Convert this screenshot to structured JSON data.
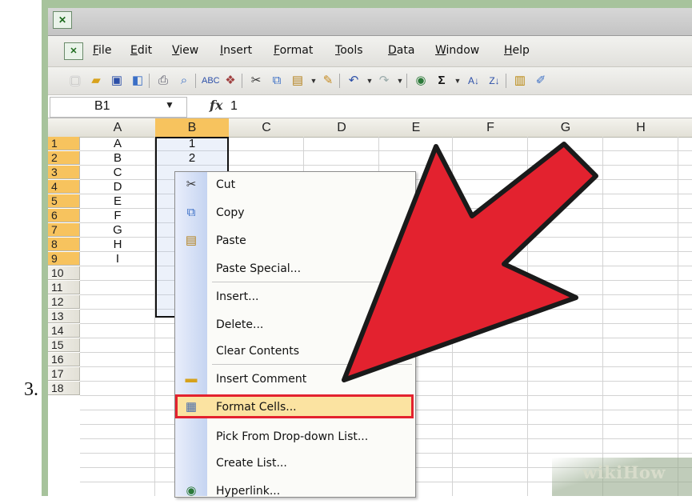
{
  "step_label": "3.",
  "menubar": {
    "items": [
      "File",
      "Edit",
      "View",
      "Insert",
      "Format",
      "Tools",
      "Data",
      "Window",
      "Help"
    ]
  },
  "toolbar": {
    "icons": [
      "new-icon",
      "open-icon",
      "save-icon",
      "permission-icon",
      "print-icon",
      "print-preview-icon",
      "spelling-icon",
      "research-icon",
      "cut-icon",
      "copy-icon",
      "paste-icon",
      "format-painter-icon",
      "undo-icon",
      "redo-icon",
      "hyperlink-icon",
      "autosum-icon",
      "sort-ascending-icon",
      "sort-descending-icon",
      "chart-wizard-icon",
      "drawing-icon"
    ],
    "autosum_label": "Σ"
  },
  "formula_bar": {
    "name_box": "B1",
    "fx_label": "fx",
    "value": "1"
  },
  "sheet": {
    "columns": [
      "A",
      "B",
      "C",
      "D",
      "E",
      "F",
      "G",
      "H"
    ],
    "rows": [
      "1",
      "2",
      "3",
      "4",
      "5",
      "6",
      "7",
      "8",
      "9",
      "10",
      "11",
      "12",
      "13",
      "14",
      "15",
      "16",
      "17",
      "18"
    ],
    "col_a": [
      "A",
      "B",
      "C",
      "D",
      "E",
      "F",
      "G",
      "H",
      "I"
    ],
    "col_b_visible": [
      "1",
      "2"
    ],
    "selected_column": "B"
  },
  "context_menu": {
    "items": [
      {
        "label": "Cut",
        "icon": "scissors-icon"
      },
      {
        "label": "Copy",
        "icon": "copy-icon"
      },
      {
        "label": "Paste",
        "icon": "clipboard-icon"
      },
      {
        "label": "Paste Special...",
        "icon": ""
      },
      {
        "label": "Insert...",
        "icon": ""
      },
      {
        "label": "Delete...",
        "icon": ""
      },
      {
        "label": "Clear Contents",
        "icon": ""
      },
      {
        "label": "Insert Comment",
        "icon": "comment-icon"
      },
      {
        "label": "Format Cells...",
        "icon": "format-cells-icon"
      },
      {
        "label": "Pick From Drop-down List...",
        "icon": ""
      },
      {
        "label": "Create List...",
        "icon": ""
      },
      {
        "label": "Hyperlink...",
        "icon": "globe-icon"
      }
    ],
    "highlighted": "Format Cells..."
  },
  "annotation": {
    "arrow_color": "#e3222f",
    "highlight_color": "#e3222f"
  },
  "watermark": "wikiHow"
}
